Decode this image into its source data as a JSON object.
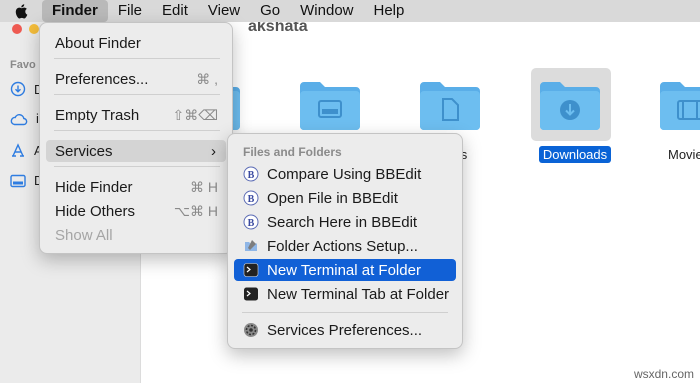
{
  "menubar": {
    "apple_icon": "apple-logo-icon",
    "items": [
      "Finder",
      "File",
      "Edit",
      "View",
      "Go",
      "Window",
      "Help"
    ]
  },
  "window": {
    "title": "akshata",
    "sidebar": {
      "section_label": "Favo",
      "items": [
        {
          "icon": "downloads-icon",
          "label": "D"
        },
        {
          "icon": "icloud-icon",
          "label": "i"
        },
        {
          "icon": "applications-icon",
          "label": "A"
        },
        {
          "icon": "desktop-icon",
          "label": "D"
        }
      ]
    },
    "folders": [
      {
        "name": ""
      },
      {
        "name": ""
      },
      {
        "name": "ents"
      },
      {
        "name": "Downloads"
      },
      {
        "name": "Movie"
      }
    ]
  },
  "finder_menu": {
    "items": [
      {
        "label": "About Finder",
        "shortcut": ""
      },
      {
        "label": "Preferences...",
        "shortcut": "⌘ ,"
      },
      {
        "label": "Empty Trash",
        "shortcut": "⇧⌘⌫"
      },
      {
        "label": "Services",
        "shortcut": "›"
      },
      {
        "label": "Hide Finder",
        "shortcut": "⌘ H"
      },
      {
        "label": "Hide Others",
        "shortcut": "⌥⌘ H"
      },
      {
        "label": "Show All",
        "shortcut": ""
      }
    ]
  },
  "services_menu": {
    "section_title": "Files and Folders",
    "items": [
      {
        "label": "Compare Using BBEdit",
        "icon": "bbedit-icon"
      },
      {
        "label": "Open File in BBEdit",
        "icon": "bbedit-icon"
      },
      {
        "label": "Search Here in BBEdit",
        "icon": "bbedit-icon"
      },
      {
        "label": "Folder Actions Setup...",
        "icon": "folder-actions-icon"
      },
      {
        "label": "New Terminal at Folder",
        "icon": "terminal-icon"
      },
      {
        "label": "New Terminal Tab at Folder",
        "icon": "terminal-icon"
      },
      {
        "label": "Services Preferences...",
        "icon": "gear-icon"
      }
    ]
  },
  "watermark": "wsxdn.com",
  "colors": {
    "highlight": "#1160d6",
    "folder_blue": "#6dbef0",
    "menubar_bg": "#d9d9d9"
  }
}
